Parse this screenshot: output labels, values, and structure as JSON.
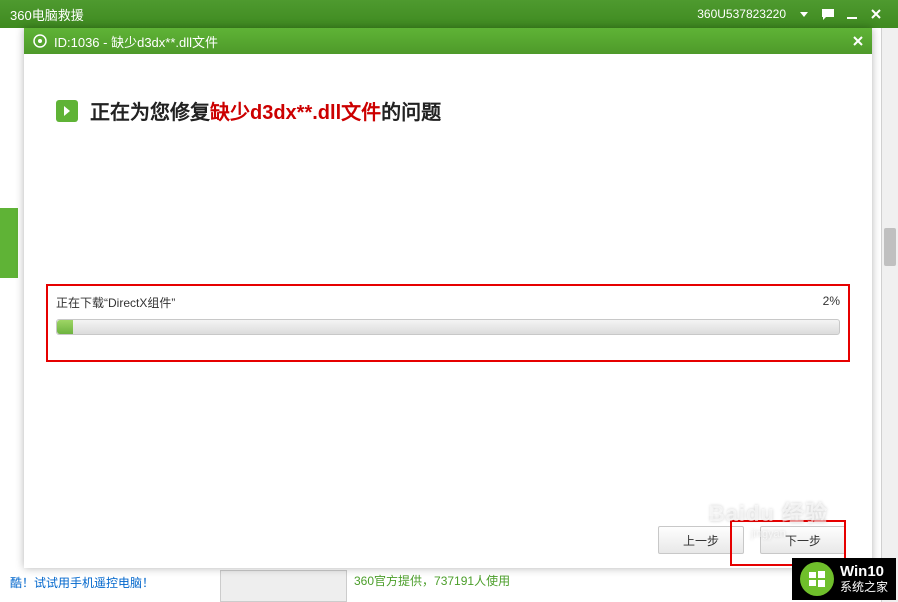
{
  "outer_window": {
    "title": "360电脑救援",
    "user_id_label": "360U537823220"
  },
  "background": {
    "bottom_link": "酷！试试用手机遥控电脑！",
    "bottom_mid_fragment": "360官方提供，737191人使用"
  },
  "dialog": {
    "id_title": "ID:1036 - 缺少d3dx**.dll文件",
    "heading_part1": "正在为您修复 ",
    "heading_highlight": "缺少d3dx**.dll文件",
    "heading_part2": " 的问题",
    "download_label": "正在下载“DirectX组件”",
    "progress_percent_label": "2%",
    "progress_value": 2,
    "buttons": {
      "prev": "上一步",
      "next": "下一步"
    }
  },
  "watermark": {
    "brand": "Baidu",
    "sub": "jingyan",
    "cn": "经验"
  },
  "corner_badge": {
    "line1": "Win10",
    "line2": "系统之家"
  }
}
